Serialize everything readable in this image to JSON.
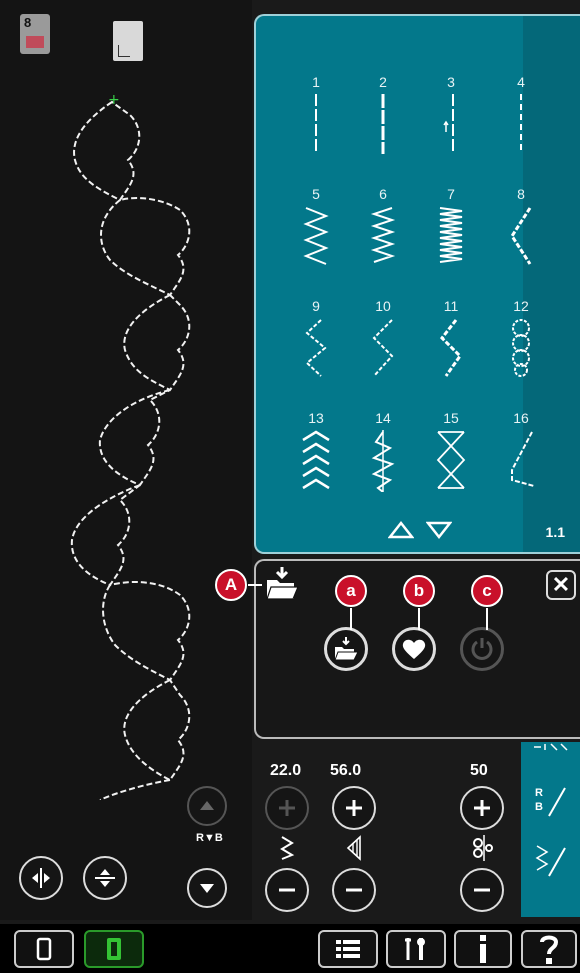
{
  "top_icons": {
    "presser_foot_number": "8",
    "presser_foot_icon": "presser-foot-icon",
    "page_icon": "page-icon"
  },
  "stitch_menu": {
    "stitches": [
      {
        "num": "1"
      },
      {
        "num": "2"
      },
      {
        "num": "3"
      },
      {
        "num": "4"
      },
      {
        "num": "5"
      },
      {
        "num": "6"
      },
      {
        "num": "7"
      },
      {
        "num": "8"
      },
      {
        "num": "9"
      },
      {
        "num": "10"
      },
      {
        "num": "11"
      },
      {
        "num": "12"
      },
      {
        "num": "13"
      },
      {
        "num": "14"
      },
      {
        "num": "15"
      },
      {
        "num": "16"
      }
    ],
    "page": "1.1"
  },
  "load_menu": {
    "callout_A": "A",
    "callout_a": "a",
    "callout_b": "b",
    "callout_c": "c",
    "icons": [
      "load-folder-icon",
      "load-from-folder-icon",
      "heart-icon",
      "power-icon"
    ]
  },
  "settings": {
    "stitch_width": "22.0",
    "stitch_length": "56.0",
    "tension": "50"
  },
  "colors": {
    "panel_teal": "#03788b",
    "callout_red": "#c9102a",
    "background": "#141414"
  }
}
